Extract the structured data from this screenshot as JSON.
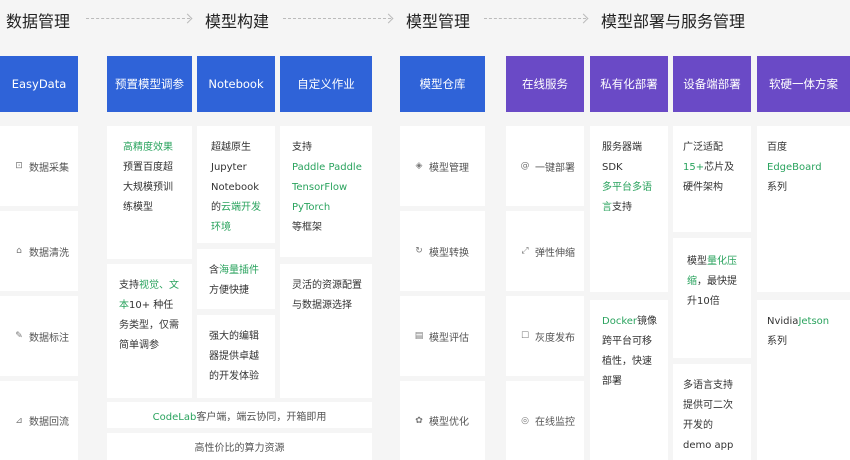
{
  "stages": [
    "数据管理",
    "模型构建",
    "模型管理",
    "模型部署与服务管理"
  ],
  "headers": {
    "easydata": "EasyData",
    "preset": "预置模型调参",
    "notebook": "Notebook",
    "custom": "自定义作业",
    "warehouse": "模型仓库",
    "online": "在线服务",
    "private": "私有化部署",
    "device": "设备端部署",
    "hardware": "软硬一体方案"
  },
  "data_mgmt": {
    "collect": {
      "icon": "import-icon",
      "label": "数据采集"
    },
    "clean": {
      "icon": "clean-icon",
      "label": "数据清洗"
    },
    "annotate": {
      "icon": "edit-icon",
      "label": "数据标注"
    },
    "backflow": {
      "icon": "backflow-icon",
      "label": "数据回流"
    }
  },
  "preset": {
    "c1": {
      "a": "高精度效果",
      "b": "预置百度超大规模预训练模型"
    },
    "c2": {
      "a": "支持",
      "b": "视觉、文本",
      "c": "10+ 种任务类型，仅需简单调参"
    }
  },
  "notebook": {
    "c1": {
      "a": "超越原生Jupyter Notebook的",
      "b": "云端开发环境"
    },
    "c2": {
      "a": "含",
      "b": "海量插件",
      "c": "方便快捷"
    },
    "c3": "强大的编辑器提供卓越的开发体验"
  },
  "custom": {
    "c1": {
      "a": "支持",
      "b": "Paddle Paddle",
      "c": "TensorFlow",
      "d": "PyTorch",
      "e": "等框架"
    },
    "c2": "灵活的资源配置与数据源选择"
  },
  "codelab": {
    "a": "CodeLab",
    "b": "客户端，端云协同，开箱即用"
  },
  "compute": "高性价比的算力资源",
  "warehouse": {
    "manage": {
      "icon": "layers-icon",
      "label": "模型管理"
    },
    "convert": {
      "icon": "refresh-icon",
      "label": "模型转换"
    },
    "evaluate": {
      "icon": "report-icon",
      "label": "模型评估"
    },
    "optimize": {
      "icon": "gear-icon",
      "label": "模型优化"
    }
  },
  "online": {
    "deploy": {
      "icon": "at-icon",
      "label": "一键部署"
    },
    "scale": {
      "icon": "expand-icon",
      "label": "弹性伸缩"
    },
    "gray": {
      "icon": "publish-icon",
      "label": "灰度发布"
    },
    "monitor": {
      "icon": "monitor-icon",
      "label": "在线监控"
    }
  },
  "private": {
    "c1": {
      "a": "服务器端SDK",
      "b": "多平台多语言",
      "c": "支持"
    },
    "c2": {
      "a": "Docker",
      "b": "镜像跨平台可移植性，快速部署"
    }
  },
  "device": {
    "c1": {
      "a": "广泛适配",
      "b": "15+",
      "c": "芯片及硬件架构"
    },
    "c2": {
      "a": "模型",
      "b": "量化压缩",
      "c": "，最快提升10倍"
    },
    "c3": "多语言支持提供可二次开发的demo app"
  },
  "hardware": {
    "c1": {
      "a": "百度",
      "b": "EdgeBoard",
      "c": "系列"
    },
    "c2": {
      "a": "Nvidia",
      "b": "Jetson",
      "c": "系列"
    }
  }
}
